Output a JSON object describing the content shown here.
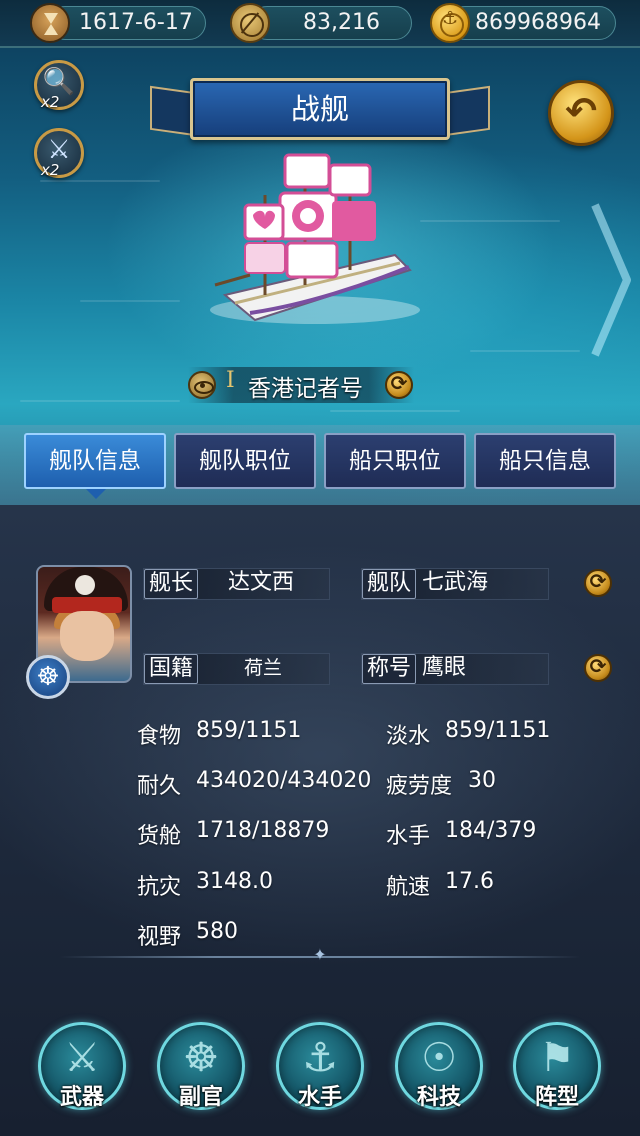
{
  "resources": {
    "date": "1617-6-17",
    "compass_value": "83,216",
    "gold": "869968964"
  },
  "side_items": [
    {
      "icon": "magnifier-icon",
      "multiplier": "x2"
    },
    {
      "icon": "crossed-swords-icon",
      "multiplier": "x2"
    }
  ],
  "title": "战舰",
  "ship": {
    "rank": "I",
    "name": "香港记者号"
  },
  "tabs": [
    {
      "label": "舰队信息",
      "active": true
    },
    {
      "label": "舰队职位",
      "active": false
    },
    {
      "label": "船只职位",
      "active": false
    },
    {
      "label": "船只信息",
      "active": false
    }
  ],
  "captain": {
    "captain_label": "舰长",
    "captain_name": "达文西",
    "fleet_label": "舰队",
    "fleet_name": "七武海",
    "nationality_label": "国籍",
    "nationality_value": "荷兰",
    "title_label": "称号",
    "title_value": "鹰眼"
  },
  "stats": {
    "food_label": "食物",
    "food_value": "859/1151",
    "water_label": "淡水",
    "water_value": "859/1151",
    "durability_label": "耐久",
    "durability_value": "434020/434020",
    "fatigue_label": "疲劳度",
    "fatigue_value": "30",
    "cargo_label": "货舱",
    "cargo_value": "1718/18879",
    "sailors_label": "水手",
    "sailors_value": "184/379",
    "resistance_label": "抗灾",
    "resistance_value": "3148.0",
    "speed_label": "航速",
    "speed_value": "17.6",
    "vision_label": "视野",
    "vision_value": "580"
  },
  "bottom_menu": [
    {
      "label": "武器",
      "icon": "cutlass-icon"
    },
    {
      "label": "副官",
      "icon": "ship-wheel-icon"
    },
    {
      "label": "水手",
      "icon": "hook-icon"
    },
    {
      "label": "科技",
      "icon": "compass-icon"
    },
    {
      "label": "阵型",
      "icon": "flag-icon"
    }
  ],
  "colors": {
    "active_tab": "#2f7bcf",
    "inactive_tab": "#26365f",
    "gold_accent": "#d4951a",
    "button_glow": "#6fd8e0"
  }
}
